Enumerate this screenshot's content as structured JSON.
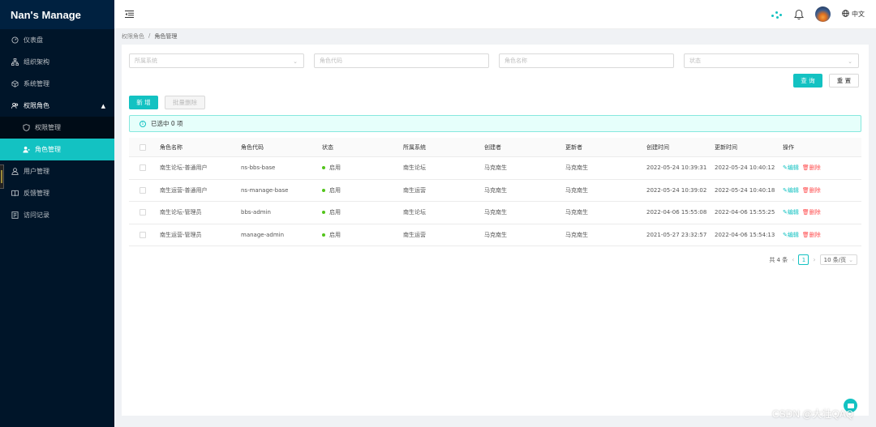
{
  "app": {
    "title": "Nan's Manage"
  },
  "sidebar": {
    "items": [
      {
        "label": "仪表盘",
        "icon": "dashboard-icon"
      },
      {
        "label": "组织架构",
        "icon": "org-tree-icon"
      },
      {
        "label": "系统管理",
        "icon": "cube-icon"
      },
      {
        "label": "权限角色",
        "icon": "team-icon"
      },
      {
        "label": "用户管理",
        "icon": "user-icon"
      },
      {
        "label": "反馈管理",
        "icon": "book-icon"
      },
      {
        "label": "访问记录",
        "icon": "log-icon"
      }
    ],
    "submenu": [
      {
        "label": "权限管理",
        "icon": "shield-icon"
      },
      {
        "label": "角色管理",
        "icon": "user-group-icon"
      }
    ]
  },
  "header": {
    "lang": "中文"
  },
  "breadcrumb": {
    "parent": "权限角色",
    "sep": "/",
    "current": "角色管理"
  },
  "filters": {
    "system_placeholder": "所属系统",
    "code_placeholder": "角色代码",
    "name_placeholder": "角色名称",
    "status_placeholder": "状态"
  },
  "buttons": {
    "query": "查 询",
    "reset": "重 置",
    "add": "新 增",
    "batch_delete": "批量删除"
  },
  "alert": {
    "text": "已选中 0 项"
  },
  "table": {
    "columns": [
      "角色名称",
      "角色代码",
      "状态",
      "所属系统",
      "创建者",
      "更新者",
      "创建时间",
      "更新时间",
      "操作"
    ],
    "rows": [
      {
        "name": "南生论坛-普通用户",
        "code": "ns-bbs-base",
        "status": "启用",
        "system": "南生论坛",
        "creator": "马克南生",
        "updater": "马克南生",
        "created": "2022-05-24 10:39:31",
        "updated": "2022-05-24 10:40:12"
      },
      {
        "name": "南生运营-普通用户",
        "code": "ns-manage-base",
        "status": "启用",
        "system": "南生运营",
        "creator": "马克南生",
        "updater": "马克南生",
        "created": "2022-05-24 10:39:02",
        "updated": "2022-05-24 10:40:18"
      },
      {
        "name": "南生论坛-管理员",
        "code": "bbs-admin",
        "status": "启用",
        "system": "南生论坛",
        "creator": "马克南生",
        "updater": "马克南生",
        "created": "2022-04-06 15:55:08",
        "updated": "2022-04-06 15:55:25"
      },
      {
        "name": "南生运营-管理员",
        "code": "manage-admin",
        "status": "启用",
        "system": "南生运营",
        "creator": "马克南生",
        "updater": "马克南生",
        "created": "2021-05-27 23:32:57",
        "updated": "2022-04-06 15:54:13"
      }
    ],
    "actions": {
      "edit": "编辑",
      "delete": "删除"
    }
  },
  "pagination": {
    "total": "共 4 条",
    "current": "1",
    "page_size": "10 条/页"
  },
  "watermark": "CSDN @大壮QAQ",
  "colors": {
    "accent": "#13c2c2",
    "sidebar": "#001529",
    "danger": "#ff4d4f",
    "success": "#52c41a"
  }
}
